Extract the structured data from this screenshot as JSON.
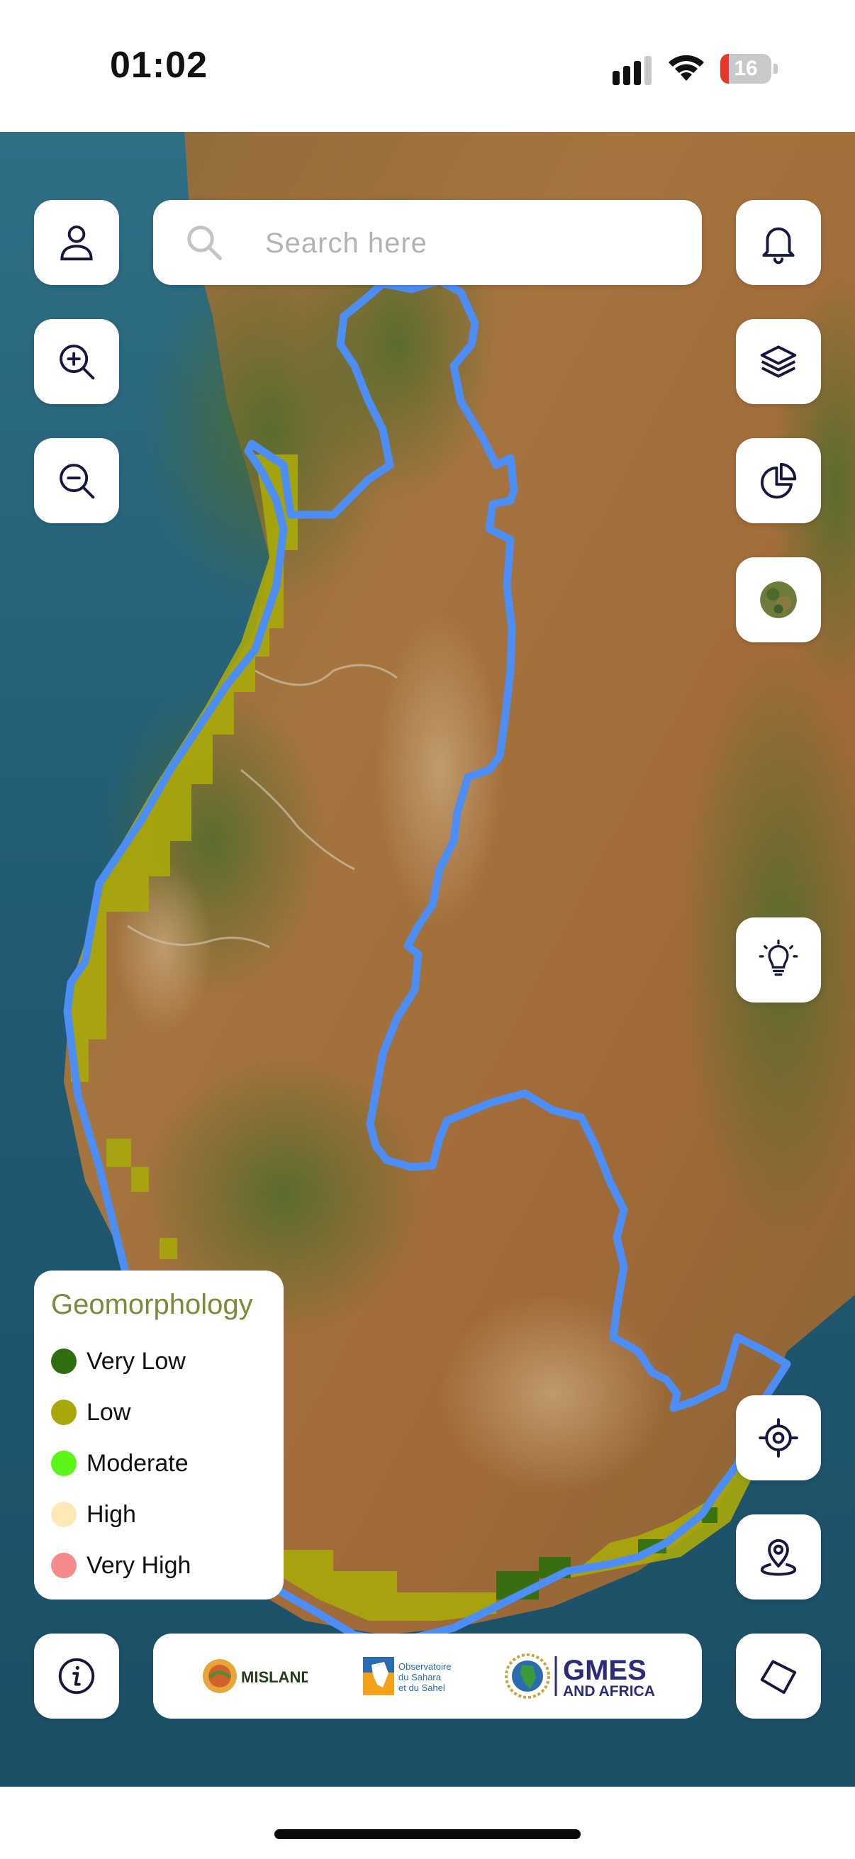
{
  "status_bar": {
    "time": "01:02",
    "battery_level": "16",
    "battery_fraction": 0.16
  },
  "search": {
    "placeholder": "Search here"
  },
  "toolbar": {
    "left": [
      "user-icon",
      "zoom-in-icon",
      "zoom-out-icon"
    ],
    "right": [
      "bell-icon",
      "layers-icon",
      "pie-chart-icon",
      "basemap-thumbnail",
      "lightbulb-icon",
      "locate-icon",
      "map-pin-icon",
      "polygon-icon"
    ],
    "bottom_left": "info-icon"
  },
  "legend": {
    "title": "Geomorphology",
    "items": [
      {
        "label": "Very Low",
        "color": "#2e6e0e"
      },
      {
        "label": "Low",
        "color": "#a8a80a"
      },
      {
        "label": "Moderate",
        "color": "#5cf51a"
      },
      {
        "label": "High",
        "color": "#fde9b6"
      },
      {
        "label": "Very High",
        "color": "#f68a8a"
      }
    ]
  },
  "logos": {
    "misland": "MISLAND",
    "oss_line1": "Observatoire",
    "oss_line2": "du Sahara",
    "oss_line3": "et du Sahel",
    "gmes_line1": "GMES",
    "gmes_line2": "AND AFRICA"
  },
  "colors": {
    "boundary": "#4c8df6",
    "icon": "#16163f",
    "legend_title": "#7c8a3a"
  }
}
